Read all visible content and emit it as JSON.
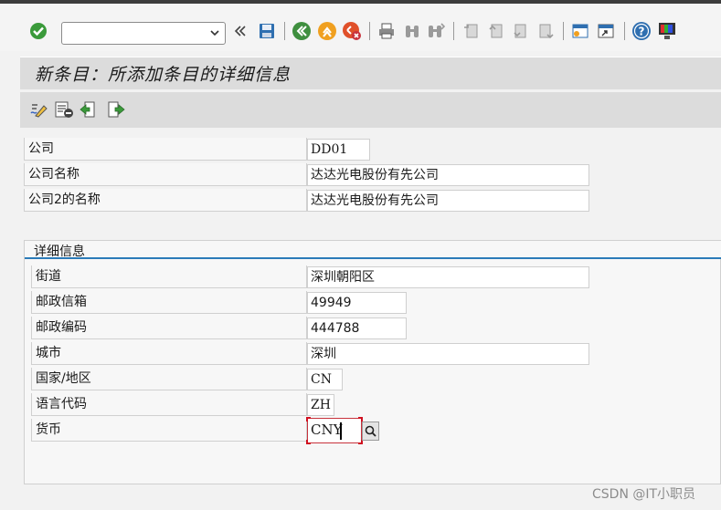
{
  "toolbar": {
    "command_value": "",
    "icons": [
      "enter-icon",
      "back-double-icon",
      "save-icon",
      "back-icon",
      "exit-icon",
      "cancel-icon",
      "print-icon",
      "find-icon",
      "find-next-icon",
      "first-page-icon",
      "previous-page-icon",
      "next-page-icon",
      "last-page-icon",
      "new-session-icon",
      "shortcut-icon",
      "help-icon",
      "customize-layout-icon"
    ]
  },
  "title": "新条目：所添加条目的详细信息",
  "app_toolbar": {
    "icons": [
      "display-change-icon",
      "delete-icon",
      "previous-entry-icon",
      "next-entry-icon"
    ]
  },
  "header_fields": [
    {
      "label": "公司",
      "value": "DD01"
    },
    {
      "label": "公司名称",
      "value": "达达光电股份有先公司"
    },
    {
      "label": "公司2的名称",
      "value": "达达光电股份有先公司"
    }
  ],
  "details": {
    "title": "详细信息",
    "fields": [
      {
        "label": "街道",
        "value": "深圳朝阳区"
      },
      {
        "label": "邮政信箱",
        "value": "49949"
      },
      {
        "label": "邮政编码",
        "value": "444788"
      },
      {
        "label": "城市",
        "value": "深圳"
      },
      {
        "label": "国家/地区",
        "value": "CN"
      },
      {
        "label": "语言代码",
        "value": "ZH"
      },
      {
        "label": "货币",
        "value": "CNY"
      }
    ]
  },
  "watermark": "CSDN @IT小职员",
  "colors": {
    "accent_blue": "#2b7bb9",
    "focus_red": "#c8323c",
    "enter_green": "#3a9a3a"
  }
}
